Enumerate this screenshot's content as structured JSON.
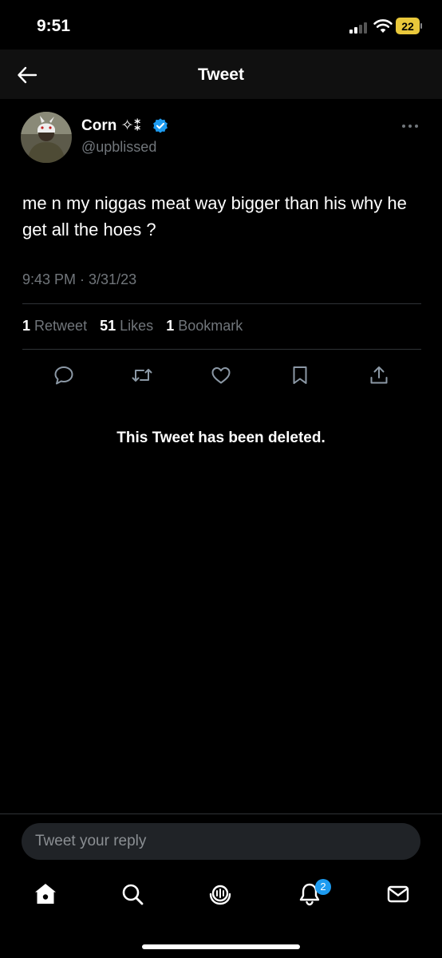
{
  "status_bar": {
    "time": "9:51",
    "battery": "22"
  },
  "header": {
    "title": "Tweet",
    "back_icon": "arrow-left-icon"
  },
  "author": {
    "name": "Corn ✧⁑",
    "handle": "@upblissed",
    "verified_color": "#1d9bf0"
  },
  "tweet": {
    "text": "me n my niggas meat way bigger than his why he get all the hoes ?",
    "timestamp": "9:43 PM · 3/31/23"
  },
  "stats": [
    {
      "count": "1",
      "label": "Retweet"
    },
    {
      "count": "51",
      "label": "Likes"
    },
    {
      "count": "1",
      "label": "Bookmark"
    }
  ],
  "actions": [
    "reply-icon",
    "retweet-icon",
    "like-icon",
    "bookmark-icon",
    "share-icon"
  ],
  "quoted": {
    "deleted_text": "This Tweet has been deleted."
  },
  "reply": {
    "placeholder": "Tweet your reply"
  },
  "tabs": [
    "home-icon",
    "search-icon",
    "spaces-icon",
    "notifications-icon",
    "messages-icon"
  ],
  "notifications_badge": "2",
  "colors": {
    "background": "#000000",
    "accent": "#1d9bf0",
    "battery": "#e9c83b",
    "muted": "#71767b"
  }
}
